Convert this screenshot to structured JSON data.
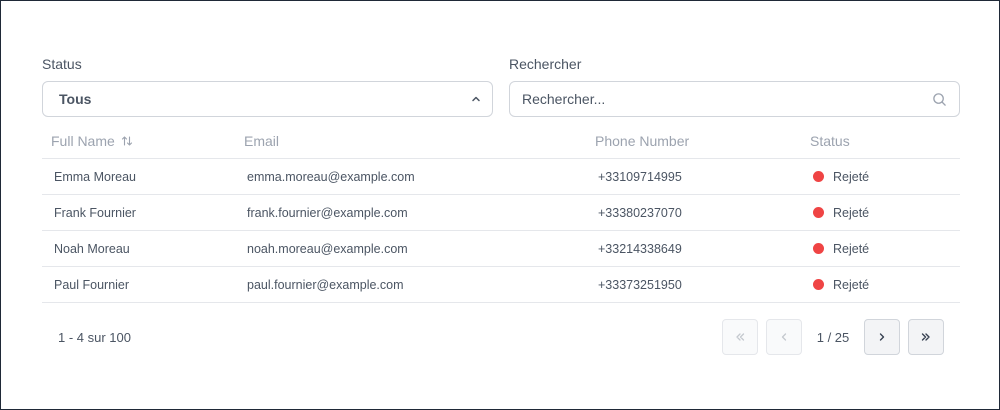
{
  "filters": {
    "status": {
      "label": "Status",
      "value": "Tous"
    },
    "search": {
      "label": "Rechercher",
      "placeholder": "Rechercher..."
    }
  },
  "table": {
    "headers": {
      "full_name": "Full Name",
      "email": "Email",
      "phone": "Phone Number",
      "status": "Status"
    },
    "rows": [
      {
        "name": "Emma Moreau",
        "email": "emma.moreau@example.com",
        "phone": "+33109714995",
        "status": "Rejeté"
      },
      {
        "name": "Frank Fournier",
        "email": "frank.fournier@example.com",
        "phone": "+33380237070",
        "status": "Rejeté"
      },
      {
        "name": "Noah Moreau",
        "email": "noah.moreau@example.com",
        "phone": "+33214338649",
        "status": "Rejeté"
      },
      {
        "name": "Paul Fournier",
        "email": "paul.fournier@example.com",
        "phone": "+33373251950",
        "status": "Rejeté"
      }
    ],
    "status_color": "#ef4444"
  },
  "pagination": {
    "range_text": "1 - 4 sur 100",
    "page_text": "1 / 25"
  },
  "icons": {
    "select": "chevron-up-icon",
    "search": "search-icon",
    "sort": "sort-icon",
    "first": "chevrons-left-icon",
    "prev": "chevron-left-icon",
    "next": "chevron-right-icon",
    "last": "chevrons-right-icon"
  }
}
